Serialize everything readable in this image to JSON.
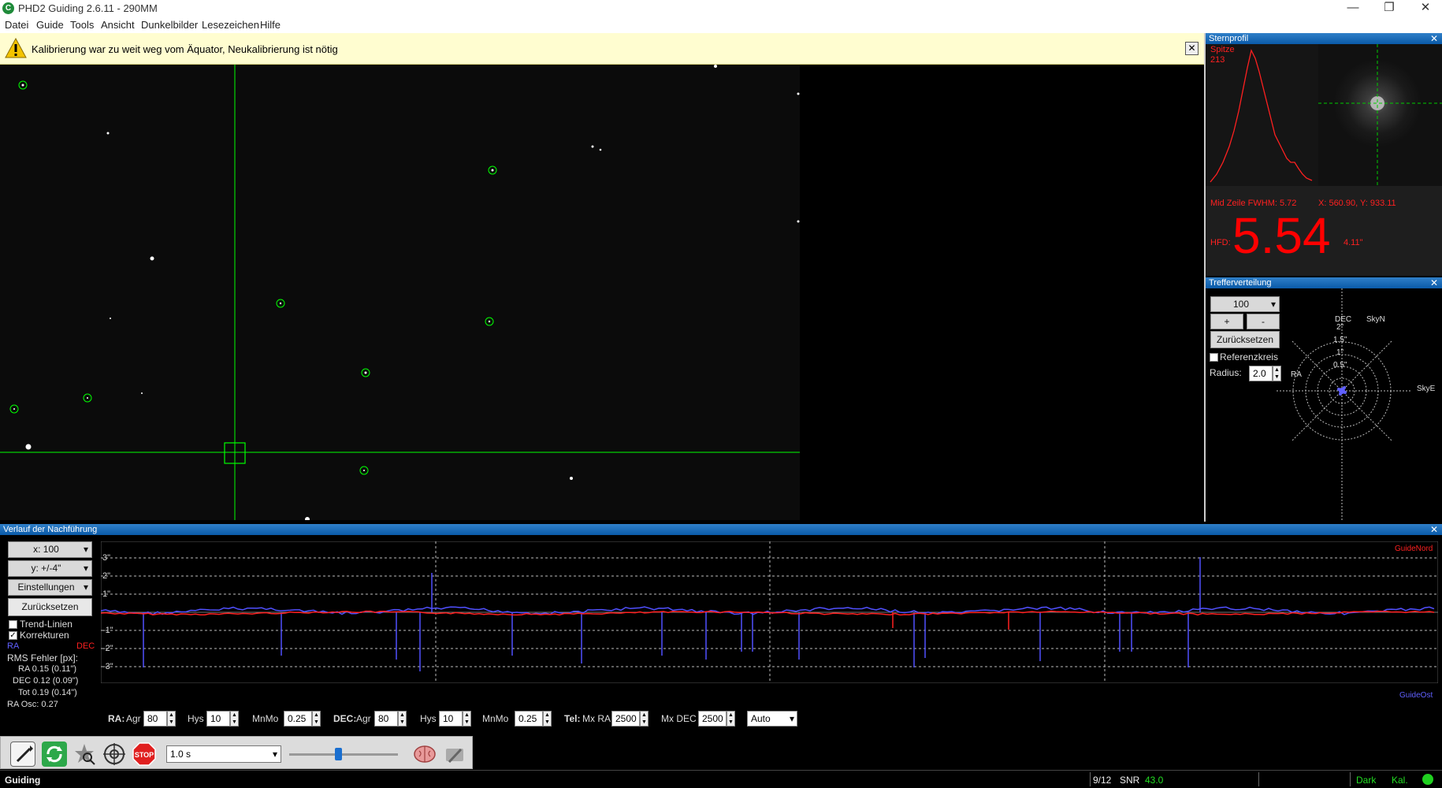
{
  "app": {
    "title": "PHD2 Guiding 2.6.11 - 290MM",
    "icon_letter": "C"
  },
  "window_controls": {
    "minimize": "—",
    "maximize": "❐",
    "close": "✕"
  },
  "menu": [
    "Datei",
    "Guide",
    "Tools",
    "Ansicht",
    "Dunkelbilder",
    "Lesezeichen",
    "Hilfe"
  ],
  "alert": {
    "text": "Kalibrierung war zu weit weg vom Äquator, Neukalibrierung ist nötig",
    "close": "✕"
  },
  "profile": {
    "title": "Sternprofil",
    "peak_label": "Spitze",
    "peak_value": "213",
    "midrow": "Mid Zeile FWHM: 5.72",
    "coords": "X: 560.90, Y: 933.11",
    "hfd_label": "HFD:",
    "hfd_value": "5.54",
    "hfd_arcsec": "4.11\""
  },
  "target": {
    "title": "Trefferverteilung",
    "count": "100",
    "plus": "+",
    "minus": "-",
    "reset": "Zurücksetzen",
    "refcircle": "Referenzkreis",
    "radius_label": "Radius:",
    "radius_value": "2.0",
    "dec_label": "DEC",
    "skyn": "SkyN",
    "ra_label": "RA",
    "skye": "SkyE",
    "rings": [
      "2\"",
      "1.5\"",
      "1\"",
      "0.5\""
    ]
  },
  "history": {
    "title": "Verlauf der Nachführung",
    "x_select": "x: 100",
    "y_select": "y: +/-4\"",
    "settings": "Einstellungen",
    "reset": "Zurücksetzen",
    "trend_lines": "Trend-Linien",
    "corrections": "Korrekturen",
    "ra": "RA",
    "dec": "DEC",
    "rms_title": "RMS Fehler [px]:",
    "rms_ra": "RA 0.15 (0.11\")",
    "rms_dec": "DEC 0.12 (0.09\")",
    "rms_tot": "Tot 0.19 (0.14\")",
    "ra_osc": "RA Osc: 0.27",
    "guide_north": "GuideNord",
    "guide_east": "GuideOst",
    "y_ticks": [
      "3\"",
      "2\"",
      "1\"",
      "-1\"",
      "-2\"",
      "-3\""
    ]
  },
  "params": {
    "ra_label": "RA:",
    "agr_label": "Agr",
    "ra_agr": "80",
    "hys_label": "Hys",
    "ra_hys": "10",
    "mnmo_label": "MnMo",
    "ra_mnmo": "0.25",
    "dec_label": "DEC:",
    "dec_agr": "80",
    "dec_hys": "10",
    "dec_mnmo": "0.25",
    "tel_label": "Tel:",
    "mxra_label": "Mx RA",
    "mxra": "2500",
    "mxdec_label": "Mx DEC",
    "mxdec": "2500",
    "mode": "Auto"
  },
  "toolbar": {
    "exposure": "1.0 s",
    "stop": "STOP",
    "exposure_fraction": 0.45
  },
  "status": {
    "left": "Guiding",
    "frames": "9/12",
    "snr_label": "SNR",
    "snr_value": "43.0",
    "dark": "Dark",
    "cal": "Kal."
  },
  "colors": {
    "accent_green": "#00ff00",
    "ra_blue": "#5050ff",
    "dec_red": "#ff2020",
    "profile_red": "#ff2020"
  }
}
